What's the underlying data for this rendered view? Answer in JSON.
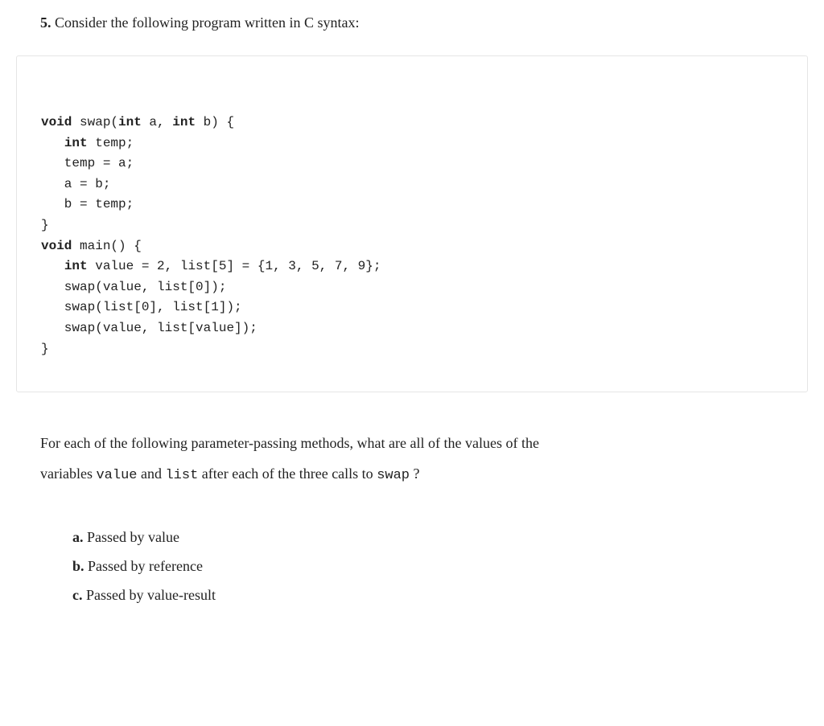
{
  "question": {
    "number": "5.",
    "prompt": " Consider the following program written in C syntax:"
  },
  "code": {
    "l1_kw1": "void",
    "l1_txt1": " swap(",
    "l1_kw2": "int",
    "l1_txt2": " a, ",
    "l1_kw3": "int",
    "l1_txt3": " b) {",
    "l2_txt1": "   ",
    "l2_kw1": "int",
    "l2_txt2": " temp;",
    "l3": "   temp = a;",
    "l4": "   a = b;",
    "l5": "   b = temp;",
    "l6": "}",
    "l7_kw1": "void",
    "l7_txt1": " main() {",
    "l8_txt1": "   ",
    "l8_kw1": "int",
    "l8_txt2": " value = 2, list[5] = {1, 3, 5, 7, 9};",
    "l9": "   swap(value, list[0]);",
    "l10": "   swap(list[0], list[1]);",
    "l11": "   swap(value, list[value]);",
    "l12": "}"
  },
  "followup": {
    "part1": "For each of the following parameter-passing methods, what are all of the values of the",
    "part2a": "variables ",
    "mono1": "value",
    "part2b": " and ",
    "mono2": "list",
    "part2c": " after each of the three calls to ",
    "mono3": "swap",
    "part2d": " ?"
  },
  "options": {
    "a": {
      "label": "a.",
      "text": " Passed by value"
    },
    "b": {
      "label": "b.",
      "text": " Passed by reference"
    },
    "c": {
      "label": "c.",
      "text": " Passed by value-result"
    }
  }
}
